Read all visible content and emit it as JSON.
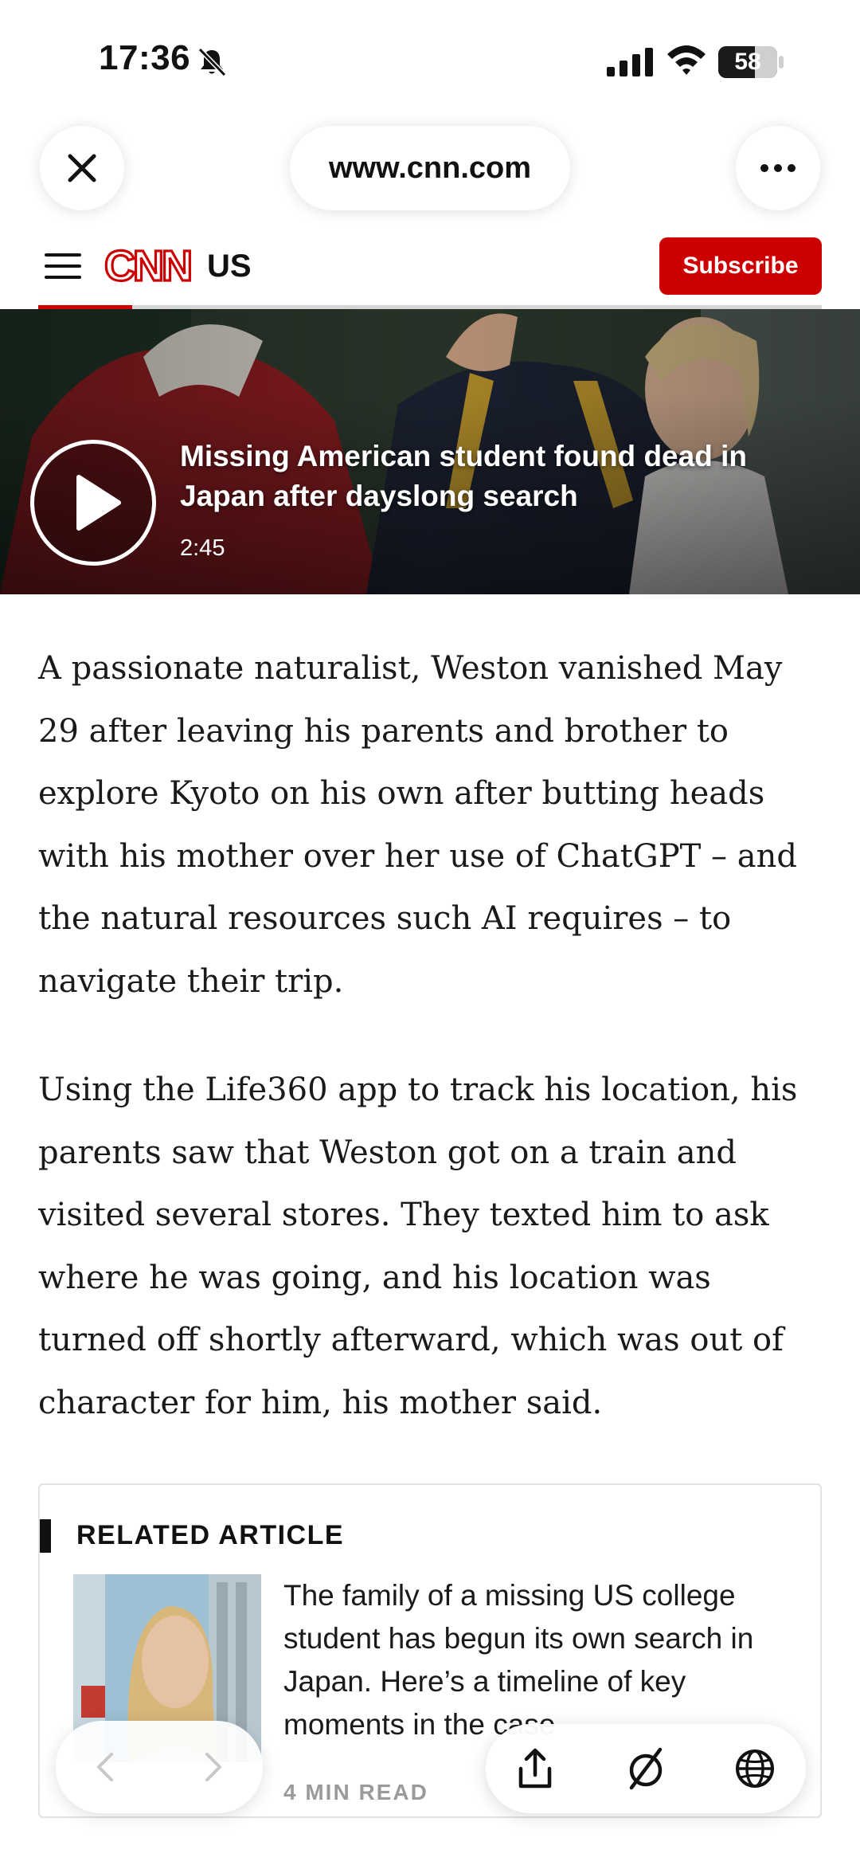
{
  "status_bar": {
    "time": "17:36",
    "battery_text": "58",
    "battery_level_percent": 58,
    "icons": [
      "bell-slash-icon",
      "signal-icon",
      "wifi-icon",
      "battery-icon"
    ]
  },
  "browser": {
    "url": "www.cnn.com",
    "icons": [
      "close-icon",
      "more-icon"
    ]
  },
  "header": {
    "logo_text": "CNN",
    "edition": "US",
    "subscribe_label": "Subscribe",
    "read_progress_percent": 12,
    "colors": {
      "brand_red": "#cc0000"
    }
  },
  "video": {
    "title": "Missing American student found dead in Japan after dayslong search",
    "duration": "2:45"
  },
  "article": {
    "paragraphs": [
      "A passionate naturalist, Weston vanished May 29 after leaving his parents and brother to explore Kyoto on his own after butting heads with his mother over her use of ChatGPT – and the natural resources such AI requires – to navigate their trip.",
      "Using the Life360 app to track his location, his parents saw that Weston got on a train and visited several stores. They texted him to ask where he was going, and his location was turned off shortly afterward, which was out of character for him, his mother said."
    ]
  },
  "related": {
    "heading": "RELATED ARTICLE",
    "text": "The family of a missing US college student has begun its own search in Japan. Here’s a timeline of key moments in the case",
    "meta": "4 MIN READ"
  },
  "toolbar": {
    "icons": [
      "back-arrow-icon",
      "forward-arrow-icon",
      "share-icon",
      "no-tracking-icon",
      "globe-icon"
    ]
  }
}
